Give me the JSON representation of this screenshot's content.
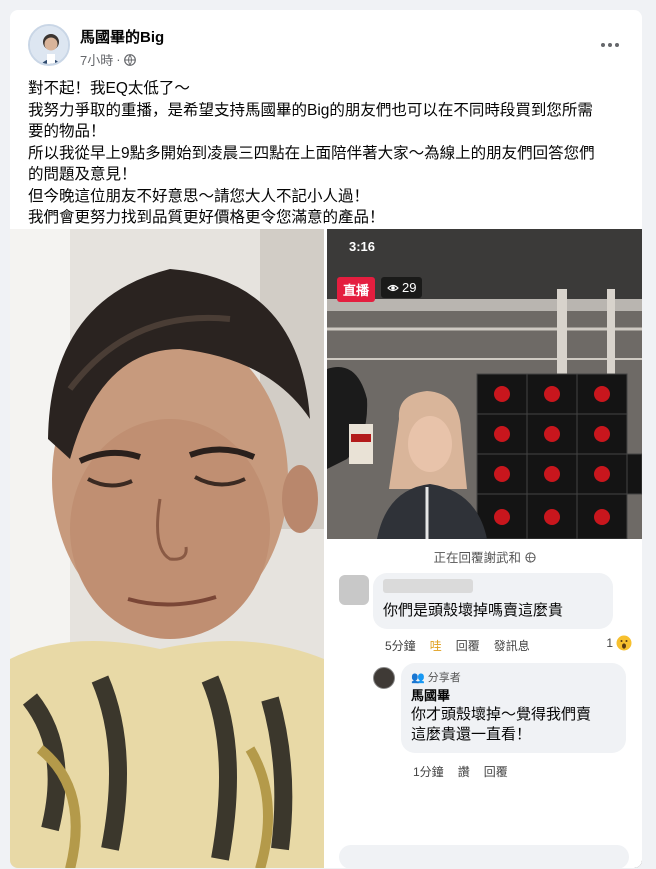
{
  "post": {
    "author": "馬國畢的Big",
    "time": "7小時",
    "separator": "·",
    "lines": [
      "對不起！我EQ太低了～",
      "我努力爭取的重播，是希望支持馬國畢的Big的朋友們也可以在不同時段買到您所需",
      "要的物品！",
      "所以我從早上9點多開始到凌晨三四點在上面陪伴著大家～為線上的朋友們回答您們",
      "的問題及意見！",
      "但今晚這位朋友不好意思～請您大人不記小人過！",
      "我們會更努力找到品質更好價格更令您滿意的產品！"
    ]
  },
  "live": {
    "status_time": "3:16",
    "badge": "直播",
    "viewers": "29",
    "replying": "正在回覆謝武和"
  },
  "comment1": {
    "text": "你們是頭殼壞掉嗎賣這麼貴",
    "time": "5分鐘",
    "reaction": "哇",
    "reply": "回覆",
    "message": "發訊息",
    "count": "1"
  },
  "comment2": {
    "badge": "分享者",
    "name": "馬國畢",
    "text1": "你才頭殼壞掉～覺得我們賣",
    "text2": "這麼貴還一直看！",
    "time": "1分鐘",
    "like": "讚",
    "reply": "回覆"
  },
  "colors": {
    "live": "#e41e3f",
    "accent": "#1877f2",
    "meta": "#65676b"
  }
}
